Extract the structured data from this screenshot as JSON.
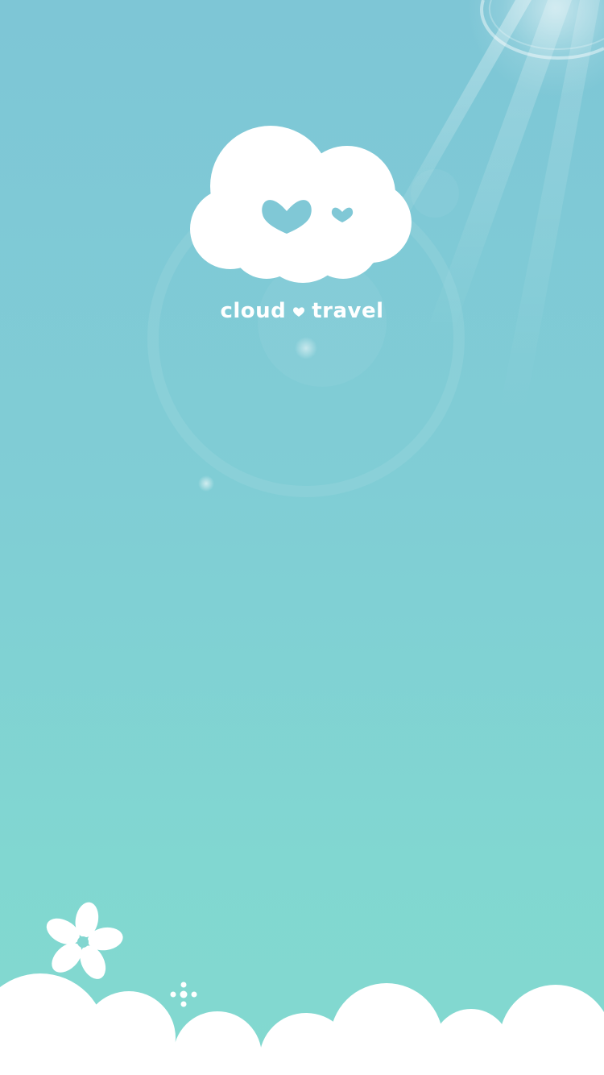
{
  "app": {
    "name_part1": "cloud",
    "name_part2": "travel",
    "logo_icon": "cloud-with-hearts-icon",
    "separator_icon": "heart-icon"
  },
  "decorations": {
    "flower_icon": "flower-icon",
    "sparkle_icon": "sparkle-icon",
    "sun_icon": "sun-flare-icon"
  },
  "colors": {
    "background_top": "#7ec6d6",
    "background_bottom": "#82d9cf",
    "foreground": "#ffffff",
    "heart_fill": "#80c8d6"
  }
}
